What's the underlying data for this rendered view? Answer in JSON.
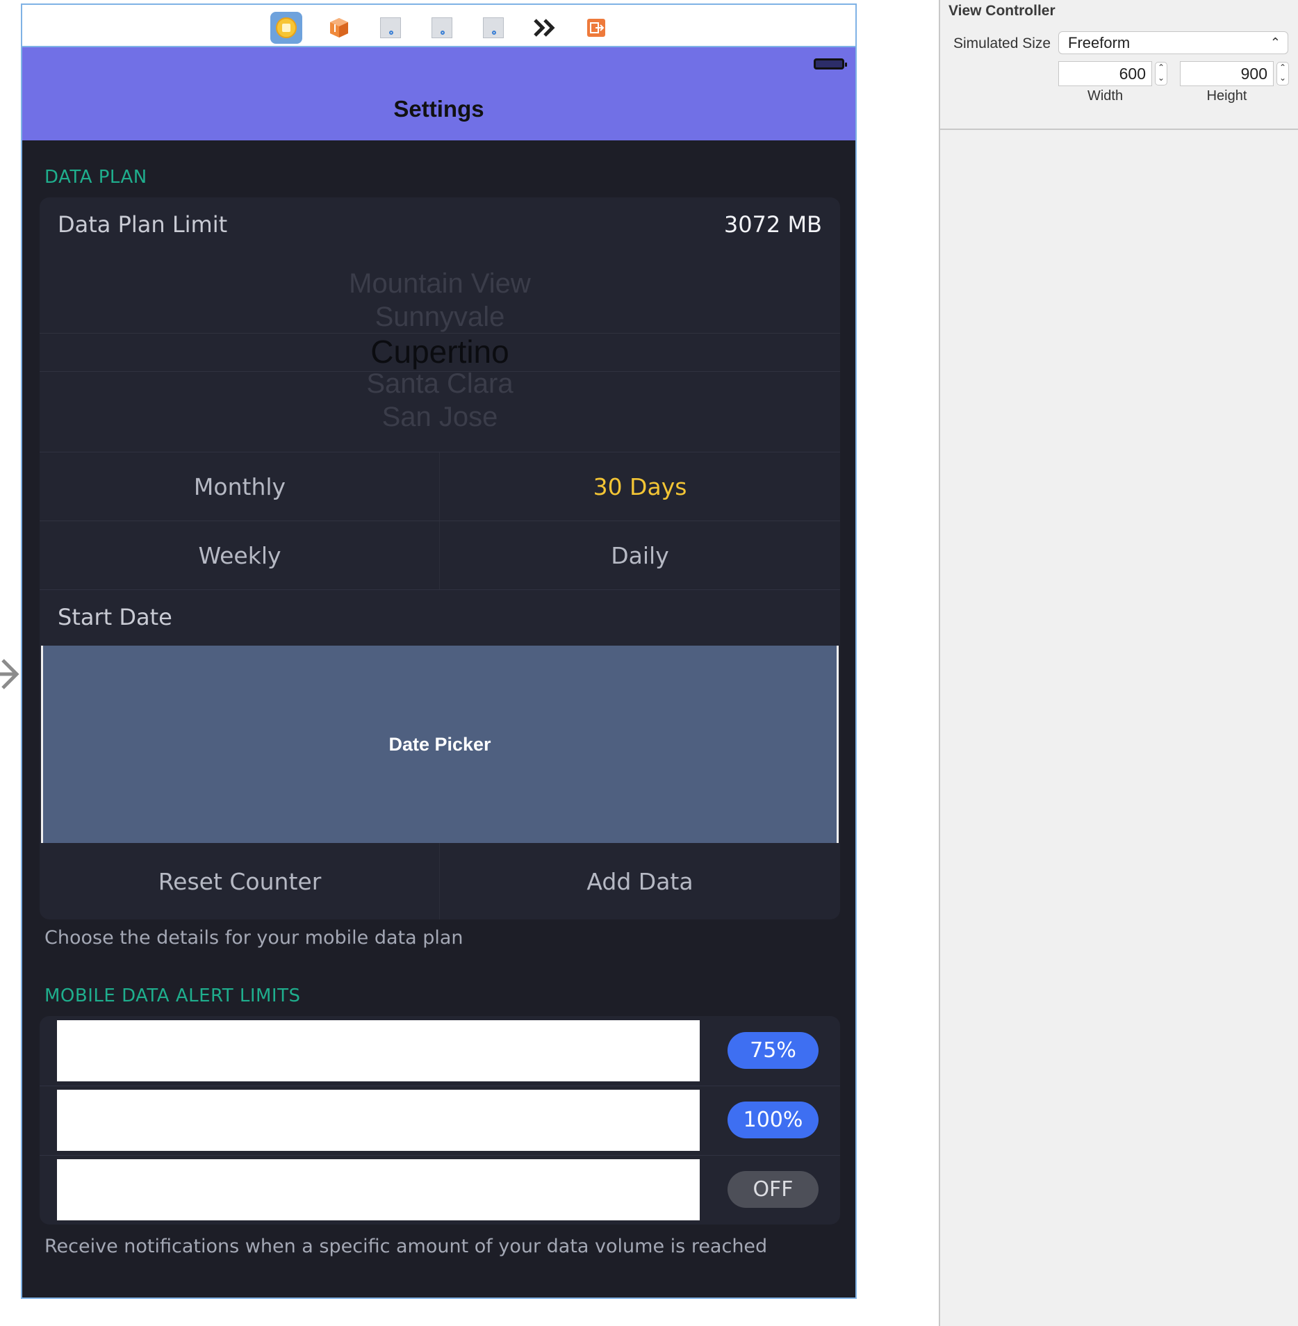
{
  "toolbar_icons": [
    "view-controller-icon",
    "first-responder-icon",
    "segue-placeholder-icon",
    "segue-placeholder-icon",
    "segue-placeholder-icon",
    "double-chevron-icon",
    "exit-icon"
  ],
  "nav": {
    "title": "Settings"
  },
  "data_plan": {
    "header": "DATA PLAN",
    "limit_label": "Data Plan Limit",
    "limit_value": "3072 MB",
    "picker_items": [
      "Mountain View",
      "Sunnyvale",
      "Cupertino",
      "Santa Clara",
      "San Jose"
    ],
    "picker_selected_index": 2,
    "periods": {
      "monthly": "Monthly",
      "days30": "30 Days",
      "weekly": "Weekly",
      "daily": "Daily"
    },
    "active_period": "30 Days",
    "start_date_label": "Start Date",
    "date_picker_label": "Date Picker",
    "reset_label": "Reset Counter",
    "add_label": "Add Data",
    "footer": "Choose the details for your mobile data plan"
  },
  "alerts": {
    "header": "MOBILE DATA ALERT LIMITS",
    "rows": [
      {
        "pill": "75%",
        "state": "on"
      },
      {
        "pill": "100%",
        "state": "on"
      },
      {
        "pill": "OFF",
        "state": "off"
      }
    ],
    "footer": "Receive notifications when a specific amount of your data volume is reached"
  },
  "inspector": {
    "title": "View Controller",
    "simulated_size_label": "Simulated Size",
    "simulated_size_value": "Freeform",
    "width_value": "600",
    "height_value": "900",
    "width_caption": "Width",
    "height_caption": "Height"
  },
  "colors": {
    "nav_bar": "#7170e6",
    "background": "#1d1e27",
    "section_header": "#1fae8d",
    "active_segment": "#f3c535",
    "pill_on": "#3e6ff2",
    "pill_off": "#4d4f58",
    "date_picker": "#4f6080"
  }
}
